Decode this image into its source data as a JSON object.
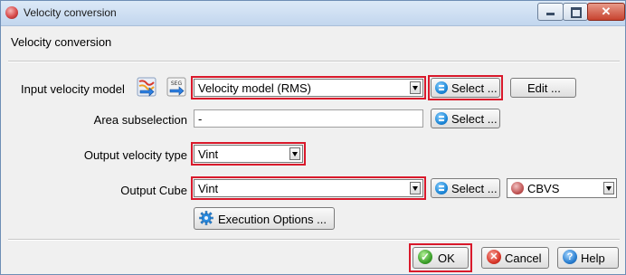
{
  "window": {
    "title": "Velocity conversion",
    "controls": {
      "minimize": "minimize",
      "maximize": "maximize",
      "close": "close"
    }
  },
  "header": {
    "text": "Velocity conversion"
  },
  "input_velocity_model": {
    "label": "Input velocity model",
    "icon_left": "velocity-model-icon",
    "icon_right": "seg-y-import-icon",
    "icon_right_text": "SEG",
    "combo_value": "Velocity model (RMS)",
    "select_label": "Select ...",
    "edit_label": "Edit ..."
  },
  "area_subselection": {
    "label": "Area subselection",
    "value": "-",
    "select_label": "Select ..."
  },
  "output_velocity_type": {
    "label": "Output velocity type",
    "value": "Vint"
  },
  "output_cube": {
    "label": "Output Cube",
    "value": "Vint",
    "select_label": "Select ...",
    "format_value": "CBVS"
  },
  "execution_options": {
    "label": "Execution Options ..."
  },
  "footer": {
    "ok_label": "OK",
    "cancel_label": "Cancel",
    "help_label": "Help"
  },
  "highlight_color": "#d9192b"
}
